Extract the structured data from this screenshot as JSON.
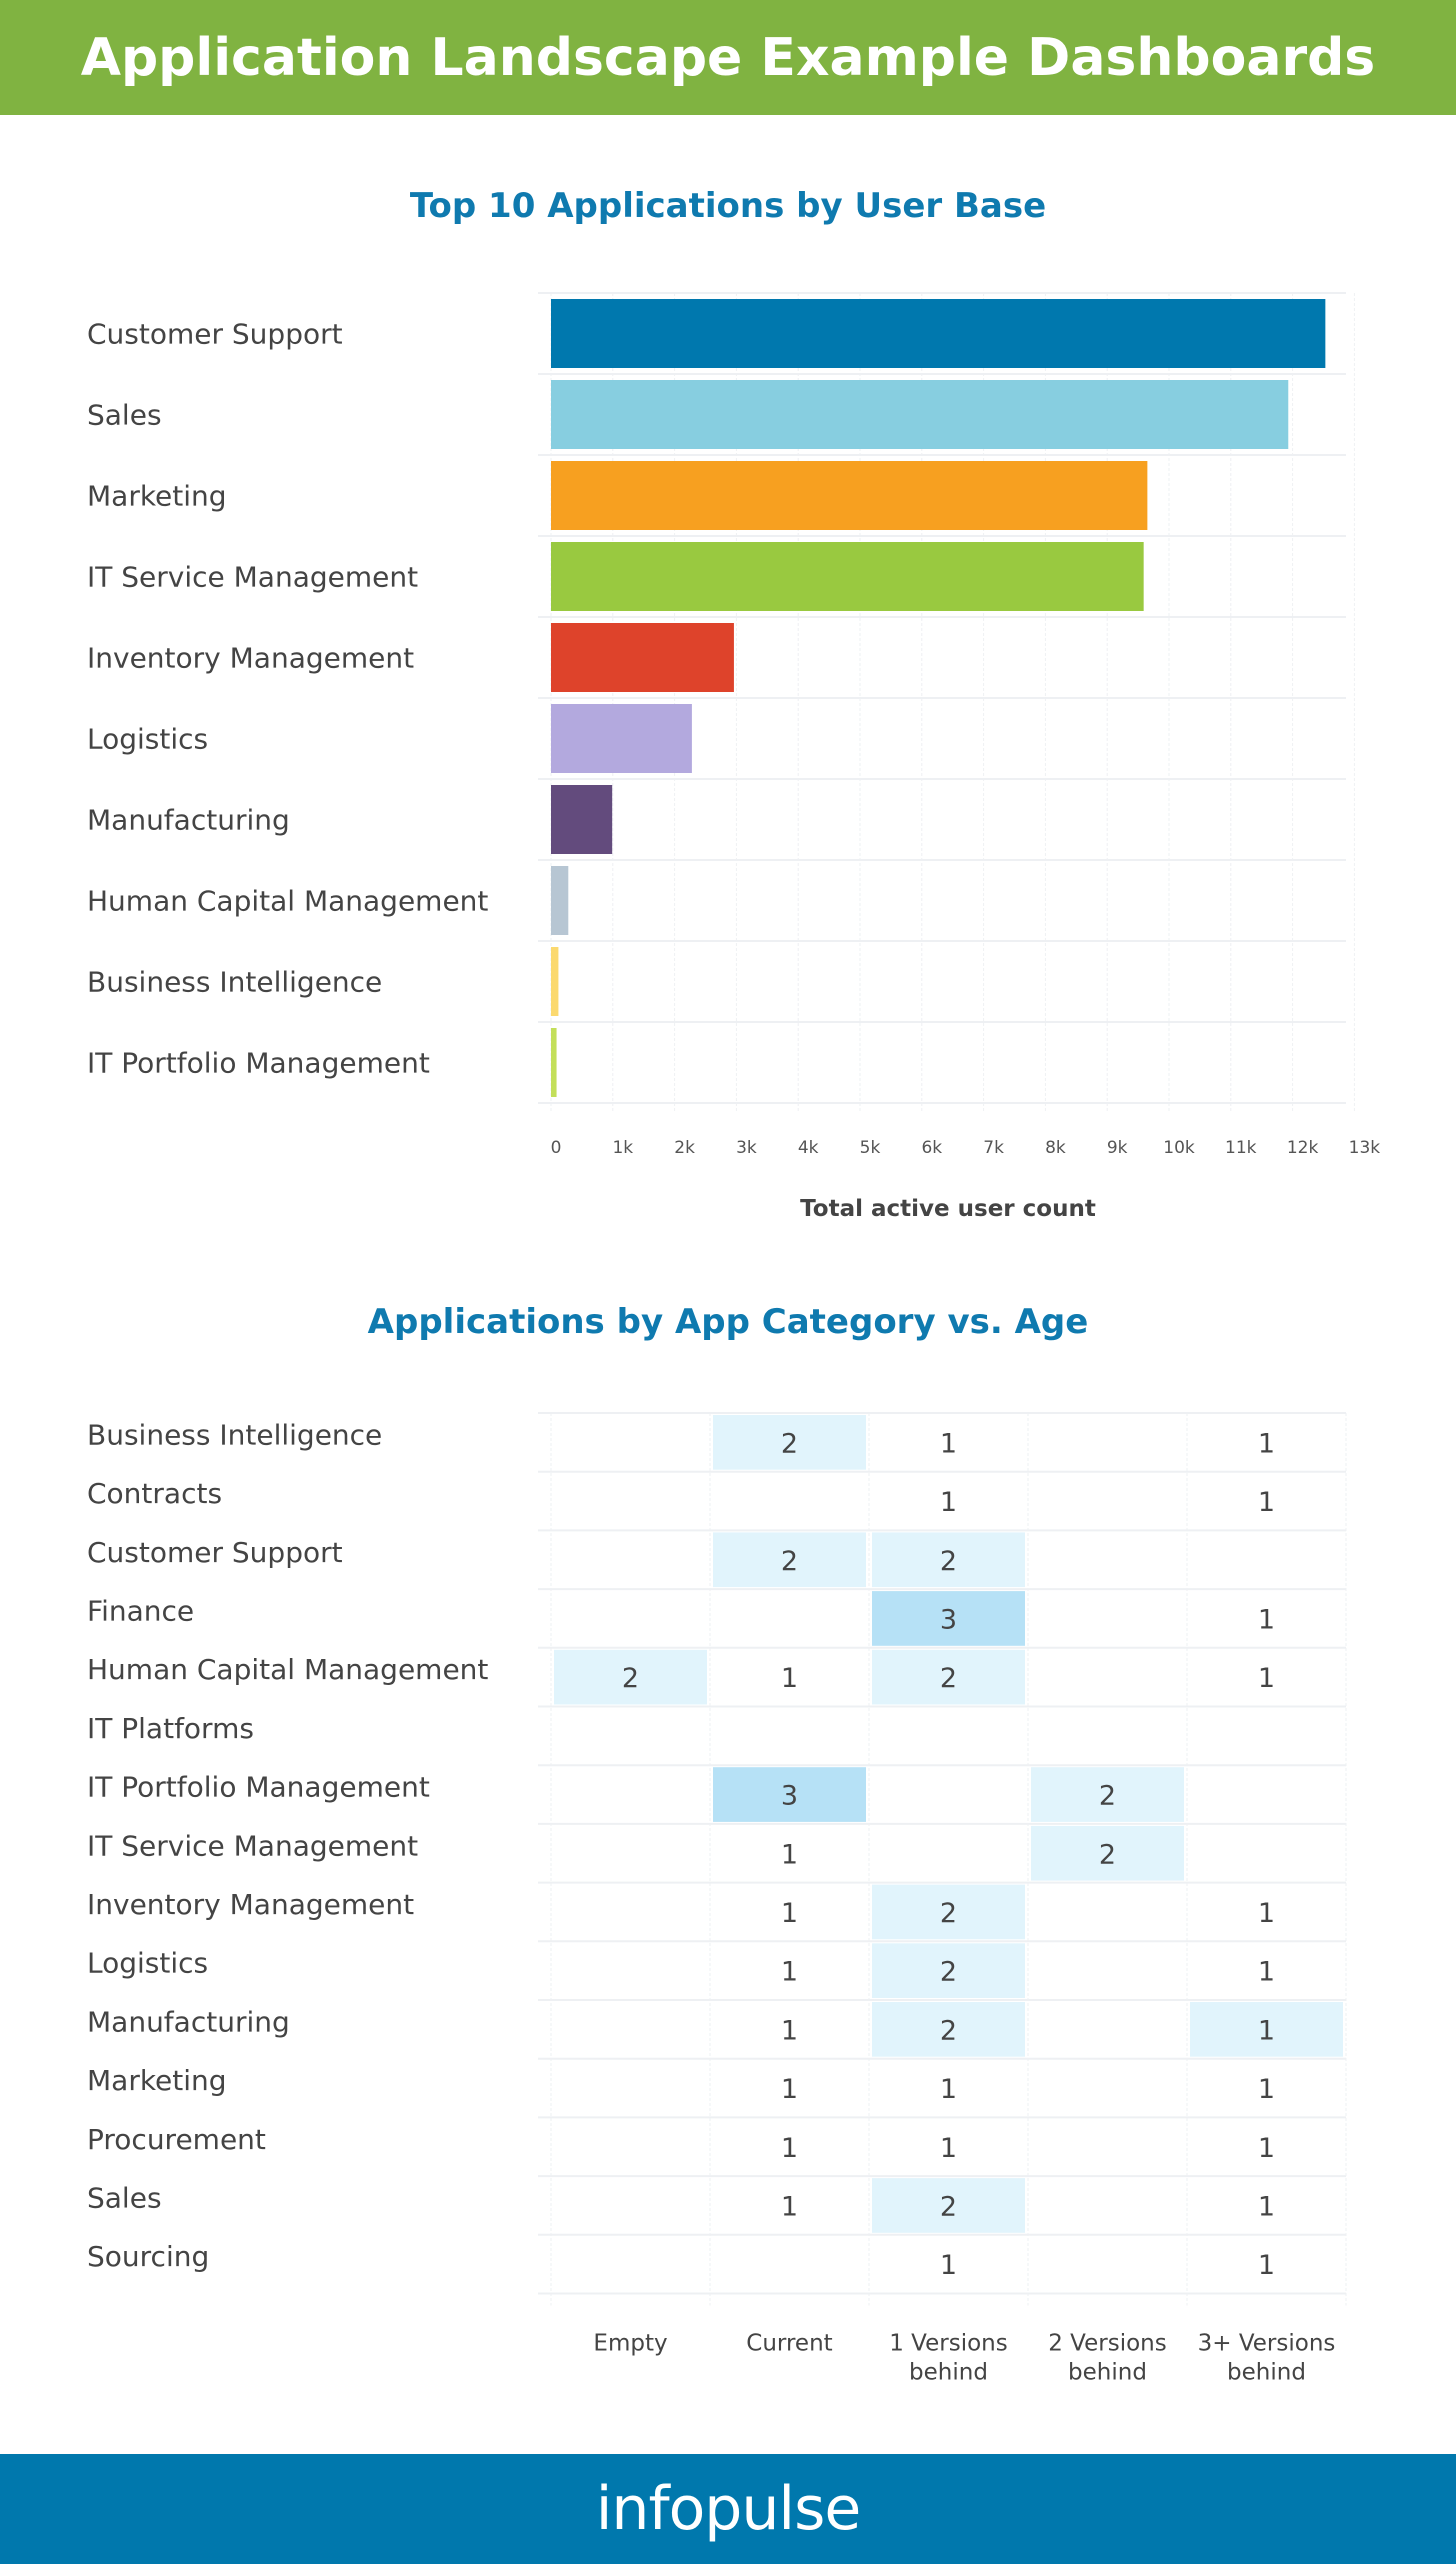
{
  "header": {
    "title": "Application Landscape Example Dashboards"
  },
  "footer": {
    "brand": "infopulse"
  },
  "colors": {
    "header_bg": "#80b341",
    "title_color": "#0f7aaf",
    "footer_bg": "#0078ad"
  },
  "chart_data": [
    {
      "type": "bar",
      "orientation": "horizontal",
      "title": "Top 10 Applications by User Base",
      "xlabel": "Total active user count",
      "ylabel": "",
      "xlim": [
        0,
        13000
      ],
      "xticks": [
        "0",
        "1k",
        "2k",
        "3k",
        "4k",
        "5k",
        "6k",
        "7k",
        "8k",
        "9k",
        "10k",
        "11k",
        "12k",
        "13k"
      ],
      "grid": true,
      "categories": [
        "Customer Support",
        "Sales",
        "Marketing",
        "IT Service Management",
        "Inventory Management",
        "Logistics",
        "Manufacturing",
        "Human Capital Management",
        "Business Intelligence",
        "IT Portfolio Management"
      ],
      "values": [
        12530,
        11930,
        9650,
        9590,
        2960,
        2280,
        990,
        280,
        120,
        90
      ],
      "bar_colors": [
        "#0078ae",
        "#87cee0",
        "#f7a020",
        "#99c940",
        "#de432b",
        "#b3a9de",
        "#634b7d",
        "#b7c6d3",
        "#fbd96f",
        "#c3df5a"
      ]
    },
    {
      "type": "heatmap",
      "title": "Applications by App Category vs. Age",
      "rows": [
        "Business Intelligence",
        "Contracts",
        "Customer Support",
        "Finance",
        "Human Capital Management",
        "IT Platforms",
        "IT Portfolio Management",
        "IT Service Management",
        "Inventory Management",
        "Logistics",
        "Manufacturing",
        "Marketing",
        "Procurement",
        "Sales",
        "Sourcing"
      ],
      "columns": [
        {
          "line1": "Empty",
          "line2": ""
        },
        {
          "line1": "Current",
          "line2": ""
        },
        {
          "line1": "1 Versions",
          "line2": "behind"
        },
        {
          "line1": "2 Versions",
          "line2": "behind"
        },
        {
          "line1": "3+ Versions",
          "line2": "behind"
        }
      ],
      "values": [
        [
          null,
          2,
          1,
          null,
          1
        ],
        [
          null,
          null,
          1,
          null,
          1
        ],
        [
          null,
          2,
          2,
          null,
          null
        ],
        [
          null,
          null,
          3,
          null,
          1
        ],
        [
          2,
          1,
          2,
          null,
          1
        ],
        [
          null,
          null,
          null,
          null,
          null
        ],
        [
          null,
          3,
          null,
          2,
          null
        ],
        [
          null,
          1,
          null,
          2,
          null
        ],
        [
          null,
          1,
          2,
          null,
          1
        ],
        [
          null,
          1,
          2,
          null,
          1
        ],
        [
          null,
          1,
          2,
          null,
          1
        ],
        [
          null,
          1,
          1,
          null,
          1
        ],
        [
          null,
          1,
          1,
          null,
          1
        ],
        [
          null,
          1,
          2,
          null,
          1
        ],
        [
          null,
          null,
          1,
          null,
          1
        ]
      ],
      "highlighted_cells": [
        [
          10,
          4
        ]
      ],
      "color_scale": {
        "1": "#ffffff",
        "2": "#e1f4fc",
        "3": "#b6e1f6",
        "highlight": "#e1f4fc"
      }
    }
  ]
}
